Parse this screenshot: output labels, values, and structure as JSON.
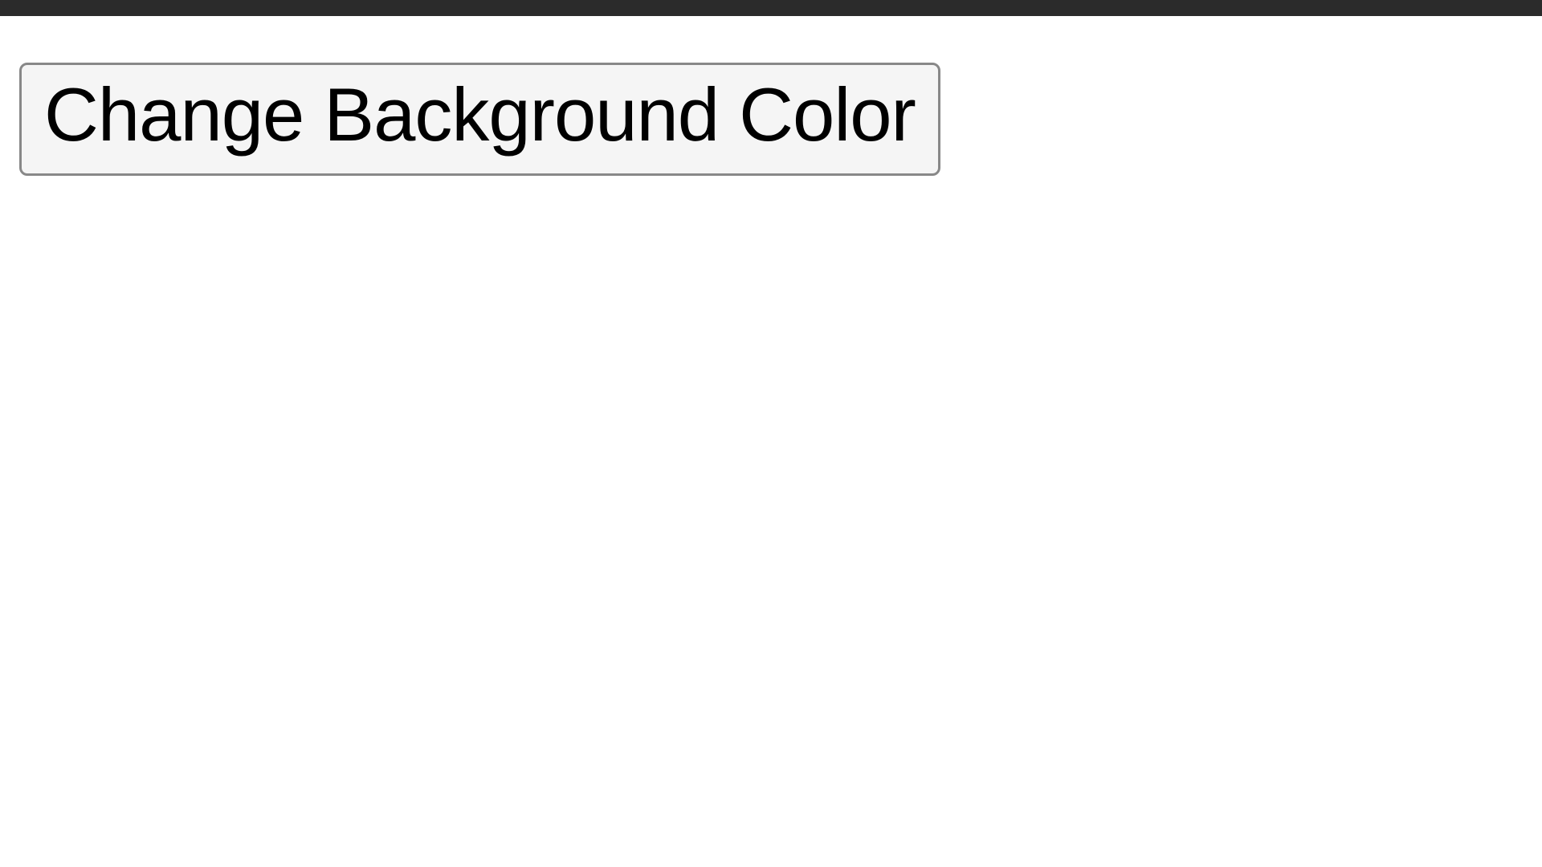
{
  "main": {
    "change_bg_button_label": "Change Background Color"
  }
}
